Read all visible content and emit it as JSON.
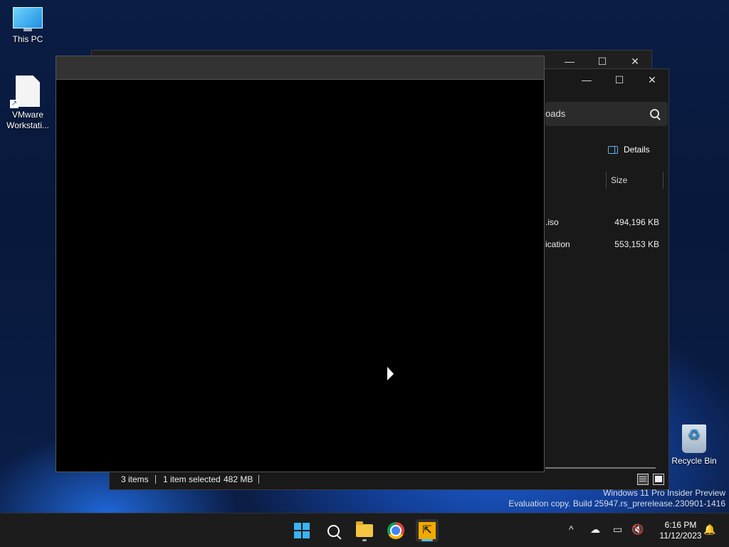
{
  "desktop": {
    "icons": [
      {
        "label": "This PC"
      },
      {
        "label": "VMware Workstati..."
      },
      {
        "label": "Recycle Bin"
      }
    ]
  },
  "back_window": {
    "controls": {
      "minimize": "—",
      "maximize": "☐",
      "close": "✕"
    }
  },
  "explorer": {
    "controls": {
      "minimize": "—",
      "maximize": "☐",
      "close": "✕"
    },
    "search_text": "oads",
    "details_label": "Details",
    "columns": {
      "size": "Size"
    },
    "files": [
      {
        "name": ".iso",
        "size": "494,196 KB"
      },
      {
        "name": "ication",
        "size": "553,153 KB"
      }
    ],
    "status": {
      "items": "3 items",
      "selected": "1 item selected",
      "selected_size": "482 MB"
    }
  },
  "watermark": {
    "line1": "Windows 11 Pro Insider Preview",
    "line2": "Evaluation copy. Build 25947.rs_prerelease.230901-1416"
  },
  "taskbar": {
    "vmware_glyph": "⇱",
    "tray": {
      "chevron": "^",
      "time": "6:16 PM",
      "date": "11/12/2023"
    }
  }
}
